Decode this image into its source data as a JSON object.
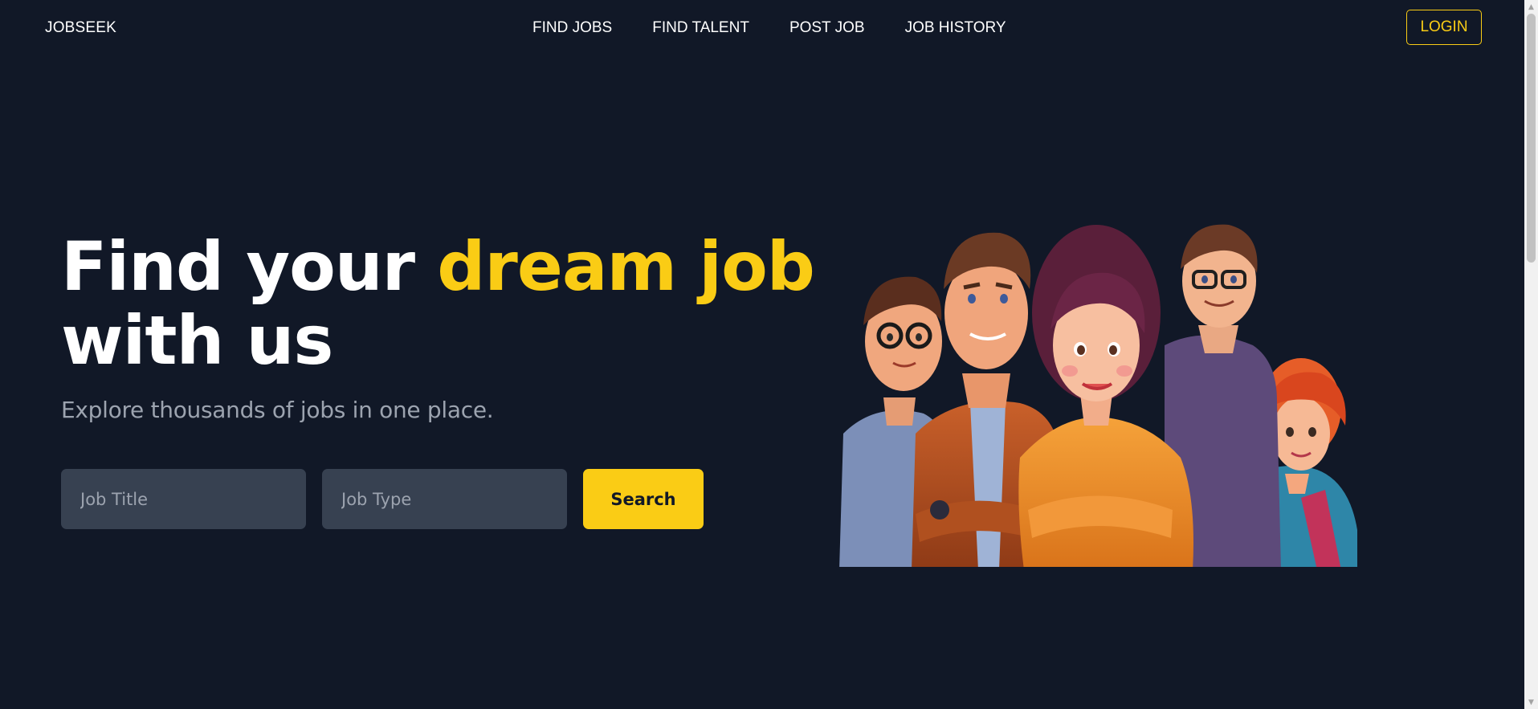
{
  "header": {
    "logo": "JOBSEEK",
    "nav": [
      "FIND JOBS",
      "FIND TALENT",
      "POST JOB",
      "JOB HISTORY"
    ],
    "login_label": "LOGIN"
  },
  "hero": {
    "title_part1": "Find your ",
    "title_accent": "dream job",
    "title_part2": "with us",
    "subtitle": "Explore thousands of jobs in one place.",
    "job_title_placeholder": "Job Title",
    "job_type_placeholder": "Job Type",
    "search_label": "Search",
    "illustration": "group-of-people-illustration"
  },
  "colors": {
    "background": "#111827",
    "accent": "#facc15",
    "input_background": "#374151",
    "muted_text": "#9ca3af"
  }
}
